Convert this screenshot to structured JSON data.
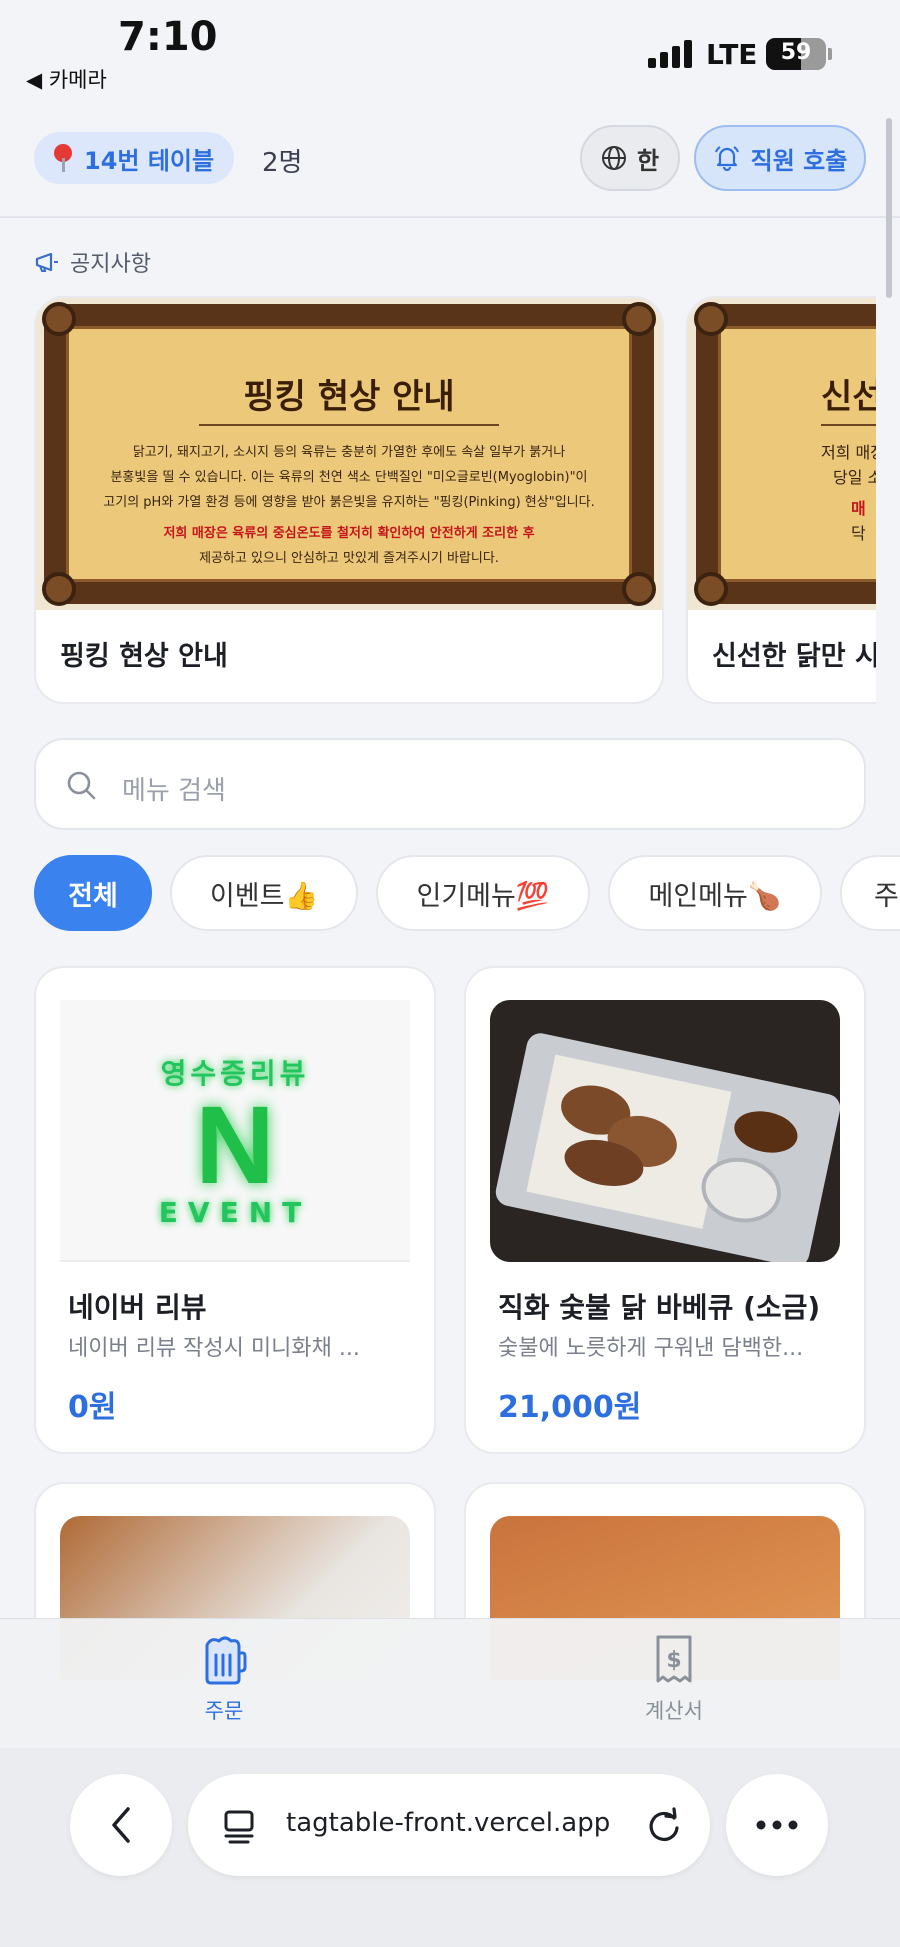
{
  "status_bar": {
    "time": "7:10",
    "back_app": "◀ 카메라",
    "network": "LTE",
    "battery": "59",
    "battery_level": 0.59
  },
  "header": {
    "table_label": "14번 테이블",
    "guest_count": "2명",
    "language_label": "한",
    "staff_call_label": "직원 호출"
  },
  "notices": {
    "section_title": "공지사항",
    "cards": [
      {
        "title": "핑킹 현상 안내",
        "poster_title": "핑킹 현상 안내",
        "poster_lines": [
          "닭고기, 돼지고기, 소시지 등의 육류는 충분히 가열한 후에도 속살 일부가 붉거나",
          "분홍빛을 띨 수 있습니다. 이는 육류의 천연 색소 단백질인 \"미오글로빈(Myoglobin)\"이",
          "고기의 pH와 가열 환경 등에 영향을 받아 붉은빛을 유지하는 \"핑킹(Pinking) 현상\"입니다."
        ],
        "poster_red_line": "저희 매장은 육류의 중심온도를 철저히 확인하여 안전하게 조리한 후",
        "poster_last_line": "제공하고 있으니 안심하고 맛있게 즐겨주시기 바랍니다."
      },
      {
        "title": "신선한 닭만 시",
        "poster_title": "신선",
        "poster_lines": [
          "저희 매장",
          "당일 소"
        ],
        "poster_red_line": "매",
        "poster_last_line": "닥"
      }
    ]
  },
  "search": {
    "placeholder": "메뉴 검색"
  },
  "categories": [
    {
      "label": "전체",
      "active": true
    },
    {
      "label": "이벤트👍",
      "active": false
    },
    {
      "label": "인기메뉴💯",
      "active": false
    },
    {
      "label": "메인메뉴🍗",
      "active": false
    },
    {
      "label": "주",
      "active": false
    }
  ],
  "menu_items": [
    {
      "name": "네이버 리뷰",
      "description": "네이버 리뷰 작성시 미니화채 ...",
      "price": "0원",
      "image_top_text": "영수증리뷰",
      "image_letter": "N",
      "image_bottom_text": "EVENT"
    },
    {
      "name": "직화 숯불 닭 바베큐 (소금)",
      "description": "숯불에 노릇하게 구워낸 담백한...",
      "price": "21,000원"
    }
  ],
  "bottom_nav": {
    "order_label": "주문",
    "bill_label": "계산서"
  },
  "browser": {
    "url": "tagtable-front.vercel.app"
  },
  "colors": {
    "accent": "#3a82ee",
    "price": "#2e6fe0",
    "background": "#f2f4f7"
  }
}
